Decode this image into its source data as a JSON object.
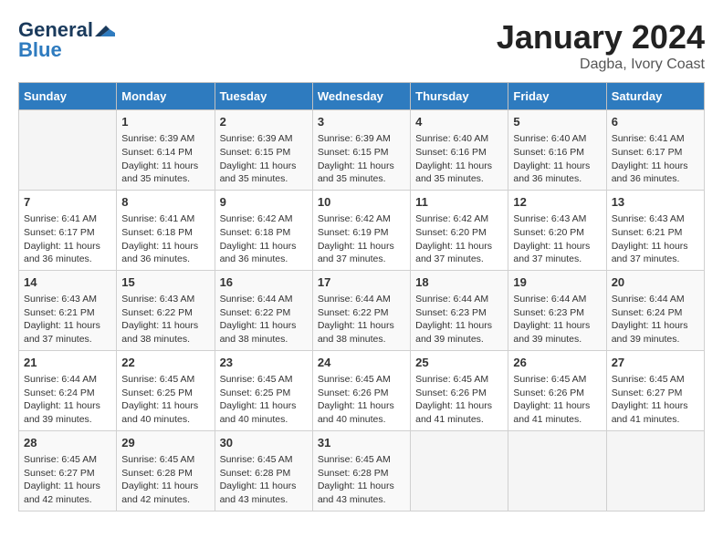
{
  "header": {
    "logo_line1": "General",
    "logo_line2": "Blue",
    "month": "January 2024",
    "location": "Dagba, Ivory Coast"
  },
  "weekdays": [
    "Sunday",
    "Monday",
    "Tuesday",
    "Wednesday",
    "Thursday",
    "Friday",
    "Saturday"
  ],
  "weeks": [
    [
      {
        "day": "",
        "info": ""
      },
      {
        "day": "1",
        "info": "Sunrise: 6:39 AM\nSunset: 6:14 PM\nDaylight: 11 hours\nand 35 minutes."
      },
      {
        "day": "2",
        "info": "Sunrise: 6:39 AM\nSunset: 6:15 PM\nDaylight: 11 hours\nand 35 minutes."
      },
      {
        "day": "3",
        "info": "Sunrise: 6:39 AM\nSunset: 6:15 PM\nDaylight: 11 hours\nand 35 minutes."
      },
      {
        "day": "4",
        "info": "Sunrise: 6:40 AM\nSunset: 6:16 PM\nDaylight: 11 hours\nand 35 minutes."
      },
      {
        "day": "5",
        "info": "Sunrise: 6:40 AM\nSunset: 6:16 PM\nDaylight: 11 hours\nand 36 minutes."
      },
      {
        "day": "6",
        "info": "Sunrise: 6:41 AM\nSunset: 6:17 PM\nDaylight: 11 hours\nand 36 minutes."
      }
    ],
    [
      {
        "day": "7",
        "info": "Sunrise: 6:41 AM\nSunset: 6:17 PM\nDaylight: 11 hours\nand 36 minutes."
      },
      {
        "day": "8",
        "info": "Sunrise: 6:41 AM\nSunset: 6:18 PM\nDaylight: 11 hours\nand 36 minutes."
      },
      {
        "day": "9",
        "info": "Sunrise: 6:42 AM\nSunset: 6:18 PM\nDaylight: 11 hours\nand 36 minutes."
      },
      {
        "day": "10",
        "info": "Sunrise: 6:42 AM\nSunset: 6:19 PM\nDaylight: 11 hours\nand 37 minutes."
      },
      {
        "day": "11",
        "info": "Sunrise: 6:42 AM\nSunset: 6:20 PM\nDaylight: 11 hours\nand 37 minutes."
      },
      {
        "day": "12",
        "info": "Sunrise: 6:43 AM\nSunset: 6:20 PM\nDaylight: 11 hours\nand 37 minutes."
      },
      {
        "day": "13",
        "info": "Sunrise: 6:43 AM\nSunset: 6:21 PM\nDaylight: 11 hours\nand 37 minutes."
      }
    ],
    [
      {
        "day": "14",
        "info": "Sunrise: 6:43 AM\nSunset: 6:21 PM\nDaylight: 11 hours\nand 37 minutes."
      },
      {
        "day": "15",
        "info": "Sunrise: 6:43 AM\nSunset: 6:22 PM\nDaylight: 11 hours\nand 38 minutes."
      },
      {
        "day": "16",
        "info": "Sunrise: 6:44 AM\nSunset: 6:22 PM\nDaylight: 11 hours\nand 38 minutes."
      },
      {
        "day": "17",
        "info": "Sunrise: 6:44 AM\nSunset: 6:22 PM\nDaylight: 11 hours\nand 38 minutes."
      },
      {
        "day": "18",
        "info": "Sunrise: 6:44 AM\nSunset: 6:23 PM\nDaylight: 11 hours\nand 39 minutes."
      },
      {
        "day": "19",
        "info": "Sunrise: 6:44 AM\nSunset: 6:23 PM\nDaylight: 11 hours\nand 39 minutes."
      },
      {
        "day": "20",
        "info": "Sunrise: 6:44 AM\nSunset: 6:24 PM\nDaylight: 11 hours\nand 39 minutes."
      }
    ],
    [
      {
        "day": "21",
        "info": "Sunrise: 6:44 AM\nSunset: 6:24 PM\nDaylight: 11 hours\nand 39 minutes."
      },
      {
        "day": "22",
        "info": "Sunrise: 6:45 AM\nSunset: 6:25 PM\nDaylight: 11 hours\nand 40 minutes."
      },
      {
        "day": "23",
        "info": "Sunrise: 6:45 AM\nSunset: 6:25 PM\nDaylight: 11 hours\nand 40 minutes."
      },
      {
        "day": "24",
        "info": "Sunrise: 6:45 AM\nSunset: 6:26 PM\nDaylight: 11 hours\nand 40 minutes."
      },
      {
        "day": "25",
        "info": "Sunrise: 6:45 AM\nSunset: 6:26 PM\nDaylight: 11 hours\nand 41 minutes."
      },
      {
        "day": "26",
        "info": "Sunrise: 6:45 AM\nSunset: 6:26 PM\nDaylight: 11 hours\nand 41 minutes."
      },
      {
        "day": "27",
        "info": "Sunrise: 6:45 AM\nSunset: 6:27 PM\nDaylight: 11 hours\nand 41 minutes."
      }
    ],
    [
      {
        "day": "28",
        "info": "Sunrise: 6:45 AM\nSunset: 6:27 PM\nDaylight: 11 hours\nand 42 minutes."
      },
      {
        "day": "29",
        "info": "Sunrise: 6:45 AM\nSunset: 6:28 PM\nDaylight: 11 hours\nand 42 minutes."
      },
      {
        "day": "30",
        "info": "Sunrise: 6:45 AM\nSunset: 6:28 PM\nDaylight: 11 hours\nand 43 minutes."
      },
      {
        "day": "31",
        "info": "Sunrise: 6:45 AM\nSunset: 6:28 PM\nDaylight: 11 hours\nand 43 minutes."
      },
      {
        "day": "",
        "info": ""
      },
      {
        "day": "",
        "info": ""
      },
      {
        "day": "",
        "info": ""
      }
    ]
  ]
}
